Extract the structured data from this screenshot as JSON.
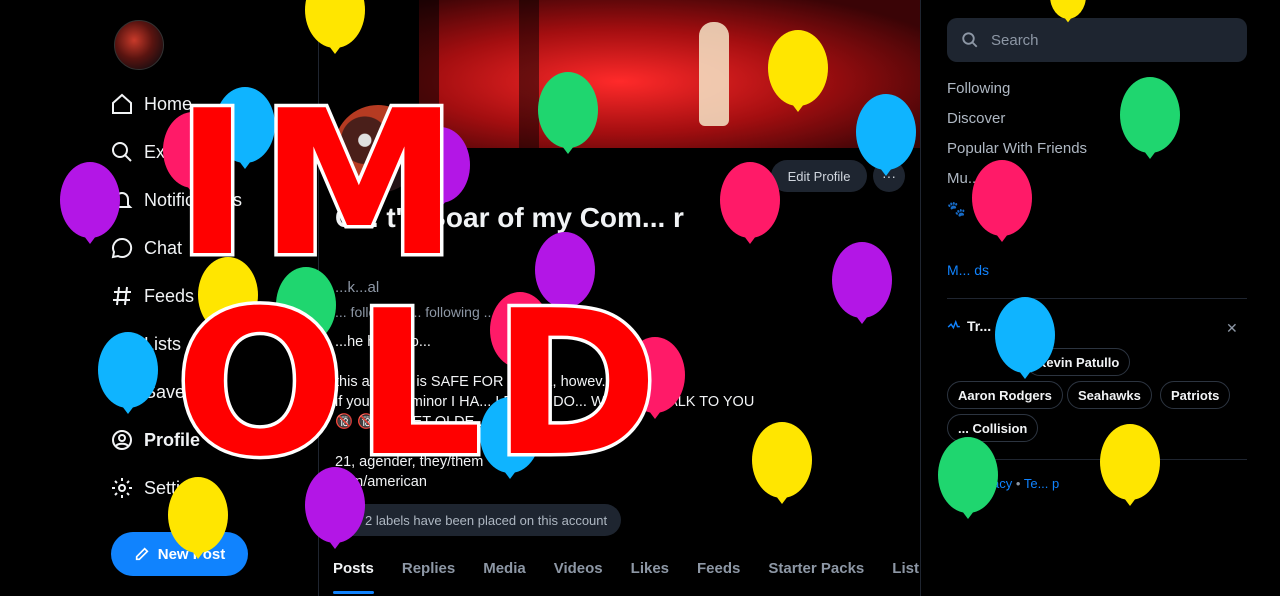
{
  "colors": {
    "accent": "#1083fe",
    "overlay_text": "#ff0000"
  },
  "nav": {
    "items": [
      {
        "label": "Home",
        "icon": "home-icon"
      },
      {
        "label": "Explore",
        "icon": "search-icon"
      },
      {
        "label": "Notifications",
        "icon": "bell-icon"
      },
      {
        "label": "Chat",
        "icon": "chat-icon"
      },
      {
        "label": "Feeds",
        "icon": "hash-icon"
      },
      {
        "label": "Lists",
        "icon": "list-icon"
      },
      {
        "label": "Saved",
        "icon": "bookmark-icon"
      },
      {
        "label": "Profile",
        "icon": "profile-icon"
      },
      {
        "label": "Settings",
        "icon": "gear-icon"
      }
    ],
    "new_post": "New Post"
  },
  "profile": {
    "display_name": "C... t's Boar of my Com... r",
    "handle": "...k...al",
    "stats": "... followers ... following ... posts",
    "bio": "...he hyeon o...\n\nthis account is SAFE FOR WORK, howev... Y RE...\nif you are a minor I HA... LEAVE I DO... WANT TO TALK TO YOU\n🔞 🔞 🔞 GET OLDE...\n\n21, agender, they/them\n...an/american",
    "labels_note": "2 labels have been placed on this account",
    "edit_profile": "Edit Profile",
    "more": "···"
  },
  "tabs": [
    "Posts",
    "Replies",
    "Media",
    "Videos",
    "Likes",
    "Feeds",
    "Starter Packs",
    "List"
  ],
  "right": {
    "search_placeholder": "Search",
    "feeds": [
      "Following",
      "Discover",
      "Popular With Friends",
      "Mu...",
      "🐾"
    ],
    "more_feeds": "M... ds",
    "trending_title": "Tr...",
    "trending_close": "✕",
    "chips": [
      "Kevin Patullo",
      "Aaron Rodgers",
      "Seahawks",
      "Patriots",
      "... Collision"
    ],
    "footer": [
      "... ",
      "Privacy",
      "Te... p"
    ]
  },
  "overlay": {
    "text": "IM OLD"
  }
}
